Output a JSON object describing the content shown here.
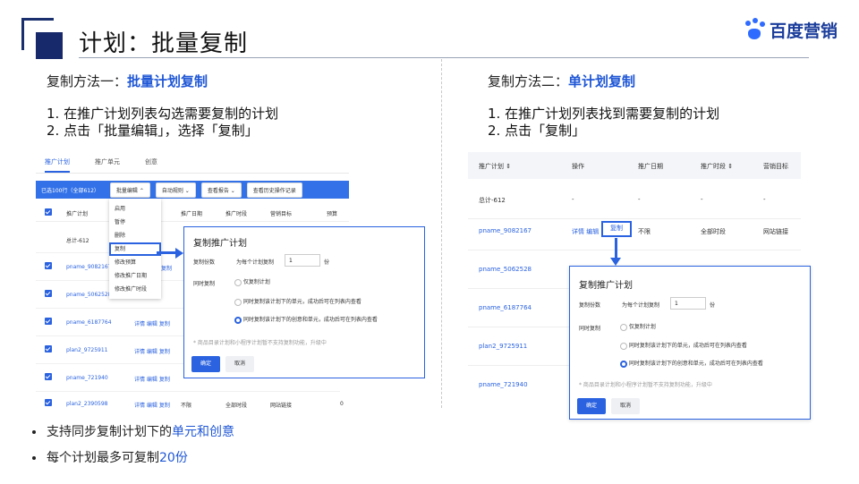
{
  "title": "计划：批量复制",
  "logo": {
    "text": "百度营销",
    "icon": "baidu-paw-icon"
  },
  "colors": {
    "accent": "#2a62e0",
    "title_deco": "#17296a"
  },
  "method1": {
    "label_prefix": "复制方法一：",
    "label_highlight": "批量计划复制",
    "steps": [
      "1.  在推广计划列表勾选需要复制的计划",
      "2.  点击「批量编辑」，选择「复制」"
    ],
    "screenshot": {
      "tabs": [
        "推广计划",
        "推广单元",
        "创意"
      ],
      "toolbar": {
        "selected": "已选100行（全部612）",
        "batch_edit": "批量编辑",
        "auto_rules": "自动规则",
        "reports": "查看报告",
        "history": "查看历史操作记录"
      },
      "columns": [
        "推广计划",
        "推广日期",
        "推广时段",
        "营销目标",
        "预算"
      ],
      "dropdown": [
        "启用",
        "暂停",
        "删除",
        "复制",
        "修改预算",
        "修改推广日期",
        "修改推广时段"
      ],
      "rows": [
        {
          "name": "总计-612",
          "ops": "",
          "date": "",
          "period": "",
          "goal": "",
          "extra": ""
        },
        {
          "name": "pname_9082167",
          "ops": "复制",
          "date": "",
          "period": "",
          "goal": "",
          "extra": ""
        },
        {
          "name": "pname_5062528",
          "ops": "复制",
          "date": "",
          "period": "",
          "goal": "",
          "extra": ""
        },
        {
          "name": "pname_6187764",
          "ops": "详情 编辑 复制",
          "date": "",
          "period": "",
          "goal": "",
          "extra": ""
        },
        {
          "name": "plan2_9725911",
          "ops": "详情 编辑 复制",
          "date": "",
          "period": "",
          "goal": "",
          "extra": ""
        },
        {
          "name": "pname_721940",
          "ops": "详情 编辑 复制",
          "date": "",
          "period": "",
          "goal": "",
          "extra": ""
        },
        {
          "name": "plan2_2390598",
          "ops": "详情 编辑 复制",
          "date": "不限",
          "period": "全部时段",
          "goal": "网站链接",
          "extra": "0"
        }
      ],
      "dialog": {
        "title": "复制推广计划",
        "copies_label": "复制份数",
        "copies_prefix": "为每个计划复制",
        "copies_value": "1",
        "copies_unit": "份",
        "sync_label": "同时复制",
        "options": [
          "仅复制计划",
          "同时复制该计划下的单元，成功后可在列表内查看",
          "同时复制该计划下的创意和单元，成功后可在列表内查看"
        ],
        "selected_option": 2,
        "note": "* 商品目录计划和小程序计划暂不支持复制功能，升级中",
        "ok": "确定",
        "cancel": "取消"
      }
    }
  },
  "method2": {
    "label_prefix": "复制方法二：",
    "label_highlight": "单计划复制",
    "steps": [
      "1.  在推广计划列表找到需要复制的计划",
      "2.  点击「复制」"
    ],
    "screenshot": {
      "columns": [
        "推广计划 ⇕",
        "操作",
        "推广日期",
        "推广时段 ⇕",
        "营销目标"
      ],
      "rows": [
        {
          "name": "总计-612",
          "ops": "-",
          "date": "-",
          "period": "-",
          "goal": "-"
        },
        {
          "name": "pname_9082167",
          "ops": "详情 编辑",
          "copy": "复制",
          "date": "不限",
          "period": "全部时段",
          "goal": "网站链接"
        },
        {
          "name": "pname_5062528"
        },
        {
          "name": "pname_6187764"
        },
        {
          "name": "plan2_9725911"
        },
        {
          "name": "pname_721940"
        }
      ],
      "dialog": {
        "title": "复制推广计划",
        "copies_label": "复制份数",
        "copies_prefix": "为每个计划复制",
        "copies_value": "1",
        "copies_unit": "份",
        "sync_label": "同时复制",
        "options": [
          "仅复制计划",
          "同时复制该计划下的单元，成功后可在列表内查看",
          "同时复制该计划下的创意和单元，成功后可在列表内查看"
        ],
        "selected_option": 2,
        "note": "* 商品目录计划和小程序计划暂不支持复制功能，升级中",
        "ok": "确定",
        "cancel": "取消"
      }
    }
  },
  "bullets": [
    {
      "text": "支持同步复制计划下的",
      "highlight": "单元和创意"
    },
    {
      "text": "每个计划最多可复制",
      "highlight": "20份"
    }
  ]
}
